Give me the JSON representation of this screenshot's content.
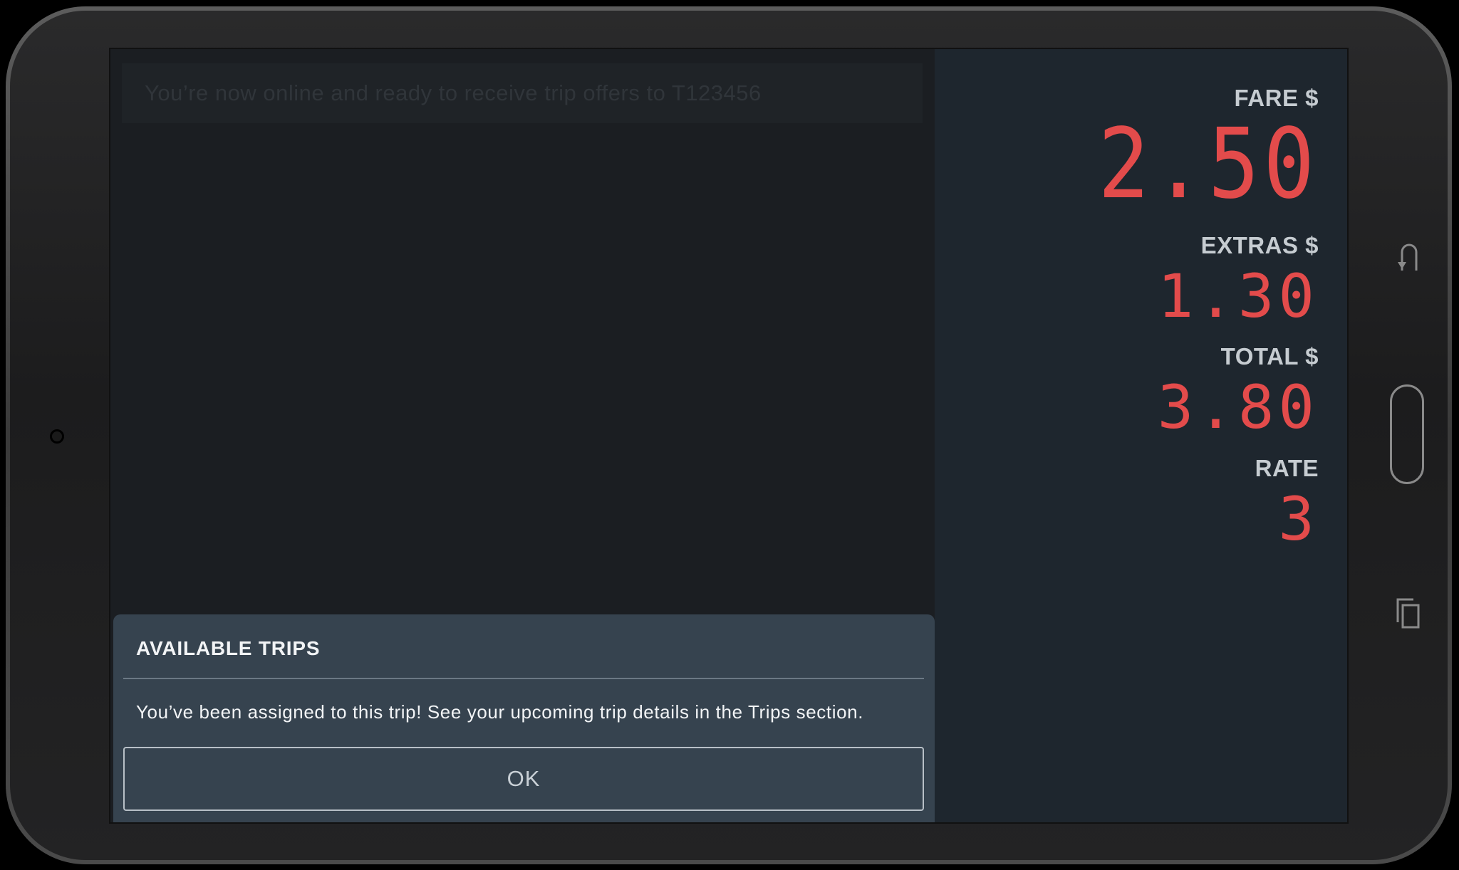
{
  "banner": {
    "text": "You’re now online and ready to receive trip offers to T123456"
  },
  "meter": {
    "fare_label": "FARE $",
    "fare_value": "2.50",
    "extras_label": "EXTRAS $",
    "extras_value": "1.30",
    "total_label": "TOTAL $",
    "total_value": "3.80",
    "rate_label": "RATE",
    "rate_value": "3"
  },
  "dialog": {
    "title": "AVAILABLE TRIPS",
    "message": "You’ve been assigned to this trip! See your upcoming trip details in the Trips section.",
    "ok_label": "OK"
  },
  "device": {
    "icons": [
      "back-icon",
      "home-button",
      "recent-apps-icon",
      "camera"
    ]
  },
  "colors": {
    "meter_value": "#e34b4b",
    "dialog_bg": "#36434f",
    "screen_bg": "#1b1e22",
    "meter_panel_bg": "#1e262e"
  }
}
